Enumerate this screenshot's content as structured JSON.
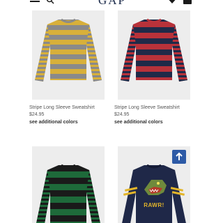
{
  "header": {
    "logo": "GAP",
    "menu_icon": "hamburger-menu-icon",
    "search_icon": "search-icon",
    "favorites_icon": "heart-icon",
    "bag_icon": "shopping-bag-icon"
  },
  "products": [
    {
      "name": "Stripe Long Sleeve Sweatshirt",
      "price": "$24.95",
      "colors_link": "see additional colors",
      "colors": {
        "a": "#d8b03a",
        "b": "#8a8a8a"
      }
    },
    {
      "name": "Stripe Long Sleeve Sweatshirt",
      "price": "$24.95",
      "colors_link": "see additional colors",
      "colors": {
        "a": "#b8323a",
        "b": "#1f2a48"
      }
    },
    {
      "colors": {
        "a": "#1e6a3a",
        "b": "#1a1a1a"
      }
    },
    {
      "graphic_text": "RAWR!",
      "colors": {
        "body": "#1f2848",
        "stripe": "#e3b52a"
      }
    }
  ],
  "back_to_top_icon": "arrow-up-icon",
  "accent_color": "#2d5aa6"
}
